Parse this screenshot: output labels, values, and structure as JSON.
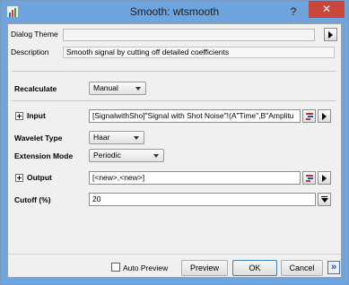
{
  "window": {
    "title": "Smooth: wtsmooth",
    "help_label": "?",
    "close_label": "✕"
  },
  "theme": {
    "label": "Dialog Theme",
    "value": "",
    "more_label": ""
  },
  "description": {
    "label": "Description",
    "text": "Smooth signal by cutting off detailed coefficients"
  },
  "params": {
    "recalculate": {
      "label": "Recalculate",
      "value": "Manual"
    },
    "input": {
      "label": "Input",
      "value": "[SignalwithSho]\"Signal with Shot Noise\"!(A\"Time\",B\"Amplitu"
    },
    "wavelet_type": {
      "label": "Wavelet Type",
      "value": "Haar"
    },
    "extension_mode": {
      "label": "Extension Mode",
      "value": "Periodic"
    },
    "output": {
      "label": "Output",
      "value": "[<new>,<new>]"
    },
    "cutoff": {
      "label": "Cutoff (%)",
      "value": "20"
    }
  },
  "footer": {
    "auto_preview_label": "Auto Preview",
    "auto_preview_checked": false,
    "preview_label": "Preview",
    "ok_label": "OK",
    "cancel_label": "Cancel",
    "more_label": "»"
  },
  "colors": {
    "titlebar": "#6ea4de",
    "close_button": "#c9463d",
    "client_background": "#f0f0f0"
  }
}
